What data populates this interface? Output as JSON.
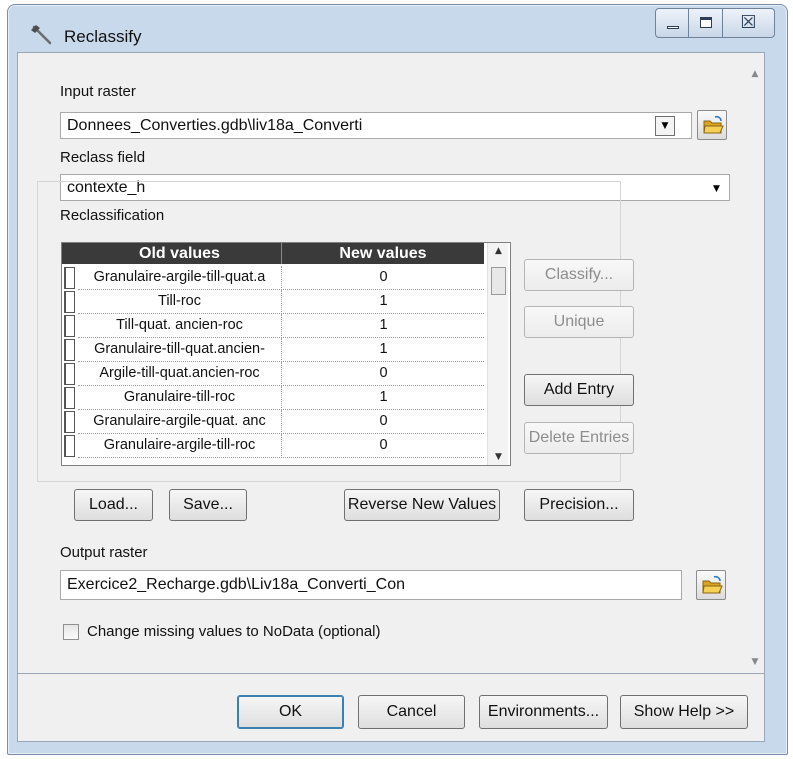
{
  "window": {
    "title": "Reclassify",
    "icon": "hammer-icon",
    "controls": {
      "minimize": "minimize-icon",
      "maximize": "maximize-icon",
      "close": "close-icon",
      "close_glyph": "☒"
    }
  },
  "input_raster": {
    "label": "Input raster",
    "value": "Donnees_Converties.gdb\\liv18a_Converti"
  },
  "reclass_field": {
    "label": "Reclass field",
    "value": "contexte_h"
  },
  "reclassification": {
    "label": "Reclassification",
    "columns": [
      "Old values",
      "New values"
    ],
    "rows": [
      {
        "old": "Granulaire-argile-till-quat.a",
        "new": "0"
      },
      {
        "old": "Till-roc",
        "new": "1"
      },
      {
        "old": "Till-quat. ancien-roc",
        "new": "1"
      },
      {
        "old": "Granulaire-till-quat.ancien-",
        "new": "1"
      },
      {
        "old": "Argile-till-quat.ancien-roc",
        "new": "0"
      },
      {
        "old": "Granulaire-till-roc",
        "new": "1"
      },
      {
        "old": "Granulaire-argile-quat. anc",
        "new": "0"
      },
      {
        "old": "Granulaire-argile-till-roc",
        "new": "0"
      }
    ],
    "buttons": {
      "classify": "Classify...",
      "unique": "Unique",
      "add_entry": "Add Entry",
      "delete_entries": "Delete Entries",
      "load": "Load...",
      "save": "Save...",
      "reverse": "Reverse New Values",
      "precision": "Precision..."
    }
  },
  "output_raster": {
    "label": "Output raster",
    "value": "Exercice2_Recharge.gdb\\Liv18a_Converti_Con"
  },
  "missing_values": {
    "label": "Change missing values to NoData (optional)",
    "checked": false
  },
  "footer": {
    "ok": "OK",
    "cancel": "Cancel",
    "environments": "Environments...",
    "show_help": "Show Help >>"
  }
}
